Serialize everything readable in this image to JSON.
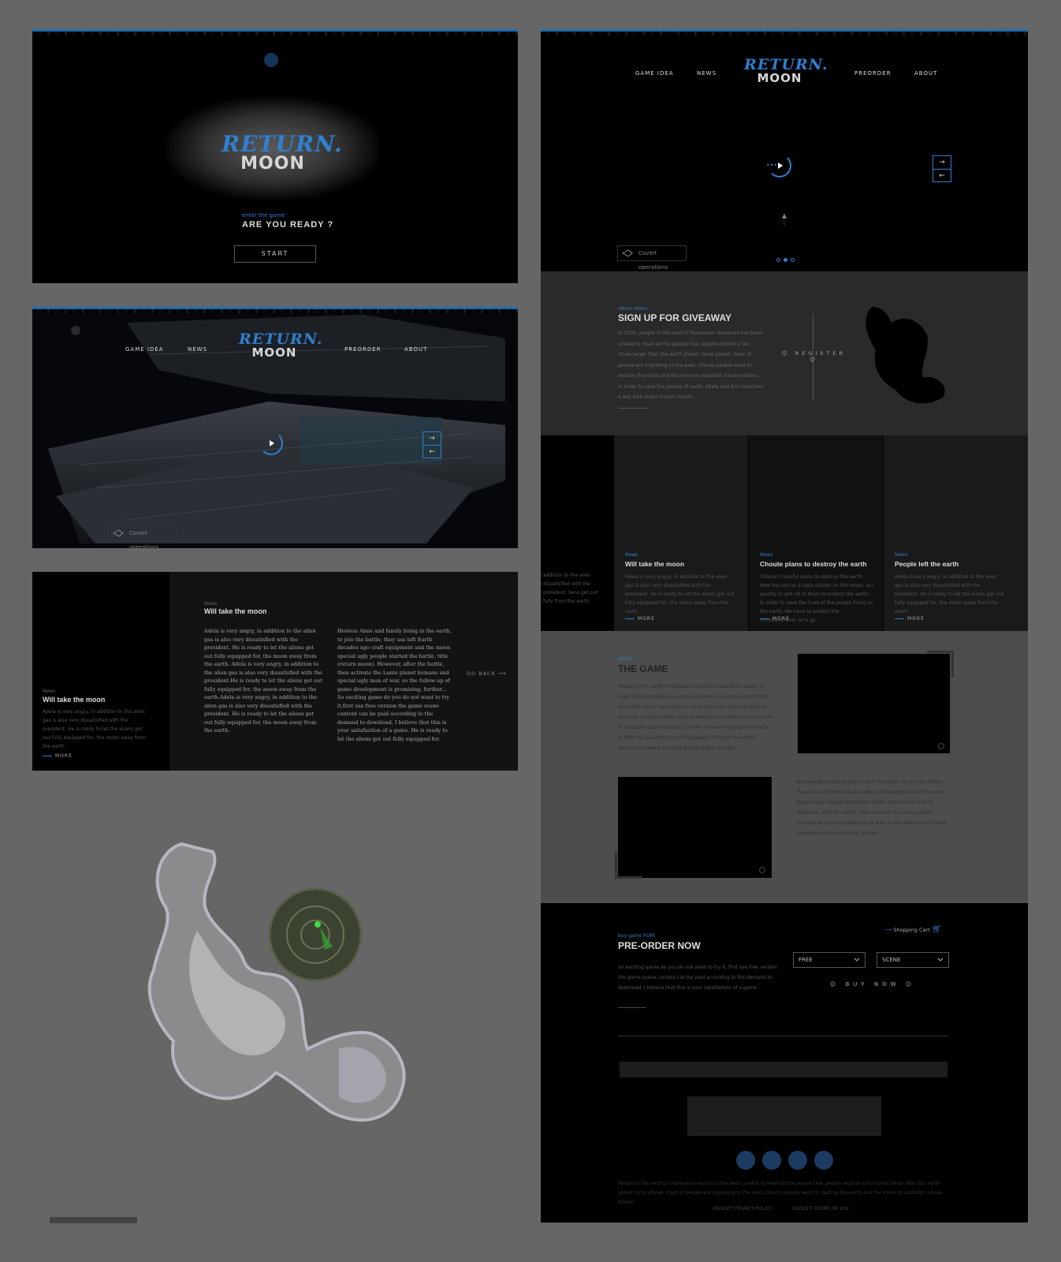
{
  "brand": {
    "line1": "RETURN.",
    "line2": "MOON"
  },
  "intro": {
    "kicker": "enter the game",
    "heading": "ARE YOU READY ?",
    "start": "START"
  },
  "nav": {
    "left": [
      "GAME IDEA",
      "NEWS"
    ],
    "right": [
      "PREORDER",
      "ABOUT"
    ]
  },
  "hero": {
    "covert": "Covert operations"
  },
  "article": {
    "side": {
      "tag": "News",
      "title": "Will take the moon",
      "text": "Adela is very angry, in addition to the alien gas is also very dissatisfied with the president. He is ready to let the aliens get out fully equipped for, the moon away from the earth",
      "more": "MORE"
    },
    "tag": "News",
    "title": "Will take the moon",
    "col1": "Adela is very angry, in addition to the alien gas is also very dissatisfied with the president. He is ready to let the aliens get out fully equipped for, the moon away from the earth. Adela is very angry, in addition to the alien gas is also very dissatisfied with the president.He is ready to let the aliens get out fully equipped for, the moon away from the earth.Adela is very angry, in addition to the alien gas is also very dissatisfied with the president. He is ready to let the aliens get out fully equipped for, the moon away from the earth.",
    "col2": "Hostess Anne and family living in the earth, to join the battle, they use left Earth decades ago craft equipment and the moon special ugly people started the battle, title (return moon). However, after the battle, then activate the Lante planet humans and special ugly man of war, so the follow-up of game development is promising, further... So exciting game do you do not want to try it,first use free version the game scene content can be paid according to the demand to download, I believe that this is your satisfaction of a game. He is ready to let the aliens get out fully equipped for.",
    "back": "GO BACK"
  },
  "giveaway": {
    "kicker": "return moon",
    "title": "SIGN UP FOR GIVEAWAY",
    "text": "In 2100, people in the earth's freshwater resources has been unable to meet all the people live, people explore a ten times larger than the earth planet -lante planet, most of people are migrating to the past. Choute people want to destroy the earth and the moon to establish a base station. In order to save the people of earth, Adela and Ann launched a war with aliens (return moon)......",
    "register": "REGISTER"
  },
  "news": [
    {
      "tag": "News",
      "title": "Will take the moon",
      "text": "Adela is very angry, in addition to the alien gas is also very dissatisfied with the president. He is ready to let the aliens get out fully equipped for, the moon away from the earth",
      "more": "MORE"
    },
    {
      "tag": "News",
      "title": "Choute plans to destroy the earth",
      "text": "Choute's hateful plans to destroy the earth. How has set up a base station on the moon, act quickly to get rid of them to protect the earth. In order to save the lives of the people living on the earth, We have to protect the homeland.Now, let's go.",
      "more": "MORE"
    },
    {
      "tag": "News",
      "title": "People left the earth",
      "text": "Adela is very angry, in addition to the alien gas is also very dissatisfied with the president. He is ready to let the aliens get out fully equipped for, the moon away from the earth",
      "more": "MORE"
    }
  ],
  "news_partial": "addition to the alien dissatisfied with the president. liens get out fully from the earth",
  "about": {
    "kicker": "about",
    "title": "THE GAME",
    "text1": "People in the earth's freshwater resources has been unable to meet all the people live, people explore a ten times larger than the earth planet -lante planet, most of people are migrating to the past. Choute people want to destroy the earth and the moon to establish a base station, in order to save the people of earth, in order to save the lives of the people living on the earth, Alberta and Adela and ugly people began to fight.",
    "text2": "Hostess Anne and family living in the earth, to join the battle, they use left Earth decades ago craft equipment and the moon special ugly people started the battle, title (return moon). However, after the battle, then activate the Lante planet humans and special ugly man of war, so the follow-up of game development is promising, further..."
  },
  "preorder": {
    "kicker": "buy game ROM",
    "title": "PRE-ORDER NOW",
    "text": "So exciting game do you do not want to try it, first use free version the game scene content can be paid according to the demand to download, I believe that this is your satisfaction of a game.",
    "cart": "Shopping Cart",
    "select1": "FREE",
    "select2": "SCENE",
    "buy": "BUY NOW"
  },
  "footer": {
    "text": "People in the earth's freshwater resources has been unable to meet all the people live, people explore a ten times larger than the earth planet lante planet, most of people are migrating to the past. Choute people want to destroy the earth and the moon to establish a base station.",
    "links": [
      "UBISOFT PRIVACY POLICY",
      "UBISOFT TERMS OF USE"
    ]
  },
  "colors": {
    "accent": "#2f7fd0",
    "bg": "#666666",
    "panel": "#000000"
  }
}
